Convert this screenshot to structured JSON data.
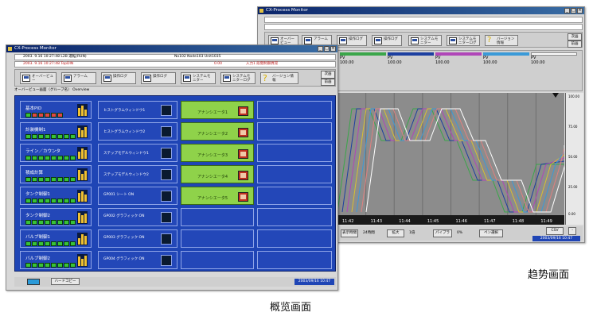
{
  "trend_window": {
    "title": "CX-Process Monitor",
    "toolbar": [
      {
        "label": "オーバービュー"
      },
      {
        "label": "アラーム"
      },
      {
        "label": "操作ログ"
      },
      {
        "label": "操作ログ"
      },
      {
        "label": "システムモニター"
      },
      {
        "label": "システムモニターログ"
      },
      {
        "label": "バージョン情報"
      }
    ],
    "right_buttons": [
      "次画",
      "前画"
    ],
    "pens": [
      {
        "color": "#3aa64a",
        "name": "PV",
        "value": "100.00"
      },
      {
        "color": "#1c3fa0",
        "name": "PV",
        "value": "100.00"
      },
      {
        "color": "#b046b8",
        "name": "PV",
        "value": "100.00"
      },
      {
        "color": "#3a9ad8",
        "name": "PV",
        "value": "100.00"
      },
      {
        "color": "#a0a0a0",
        "name": "PV",
        "value": "100.00"
      }
    ],
    "y_ticks": [
      "100.00",
      "75.00",
      "50.00",
      "25.00",
      "0.00"
    ],
    "x_ticks": [
      "11:42",
      "11:43",
      "11:44",
      "11:45",
      "11:46",
      "11:47",
      "11:48",
      "11:49"
    ],
    "footer_buttons": [
      "表示時間",
      "24時間",
      "拡大",
      "1倍",
      "パイプラ",
      "0%",
      "ペン選択",
      "CSV"
    ],
    "clock": "2003/09/16 10:47"
  },
  "overview_window": {
    "title": "CX-Process Monitor",
    "status_line1": "2003. 9.16 10:27:48  L2B  運転(RUN)",
    "status_line2": "2003. 9.16 10:27:48  TopDIN",
    "info_mid": "No102  Node103  Unit1035",
    "info_right": "0.00",
    "alarm_text": "入力1 段階制御異常",
    "toolbar": [
      {
        "label": "オーバービュー"
      },
      {
        "label": "アラーム"
      },
      {
        "label": "操作ログ"
      },
      {
        "label": "操作ログ"
      },
      {
        "label": "システムモニター"
      },
      {
        "label": "システムモニターログ"
      },
      {
        "label": "バージョン情報"
      }
    ],
    "right_buttons": [
      "次画",
      "前画"
    ],
    "breadcrumb": "オーバービュー画面（グループ名）  Overview",
    "col1": [
      "基本PID",
      "計装機制1",
      "ライン／カウンタ",
      "積成計算",
      "タンク制御1",
      "タンク制御2",
      "バルブ制御1",
      "バルブ制御2"
    ],
    "col2": [
      "ヒストグラムウィンドウ1",
      "ヒストグラムウィンドウ2",
      "ステップモデルウィンドウ1",
      "ステップモデルウィンドウ2",
      "GP001 シート  ON",
      "GP002 グラフィック  ON",
      "GP003 グラフィック  ON",
      "GP004 グラフィック  ON"
    ],
    "col3": [
      "アナンシエータ1",
      "アナンシエータ2",
      "アナンシエータ3",
      "アナンシエータ4",
      "アナンシエータ5"
    ],
    "footer_button": "ハードコピー",
    "clock": "2003/09/16 10:47"
  },
  "captions": {
    "trend": "趋势画面",
    "overview": "概览画面"
  },
  "trend_series_colors": [
    "#3aa64a",
    "#1c3fa0",
    "#b046b8",
    "#d8c030",
    "#3a9ad8",
    "#e08080",
    "#ffffff"
  ]
}
